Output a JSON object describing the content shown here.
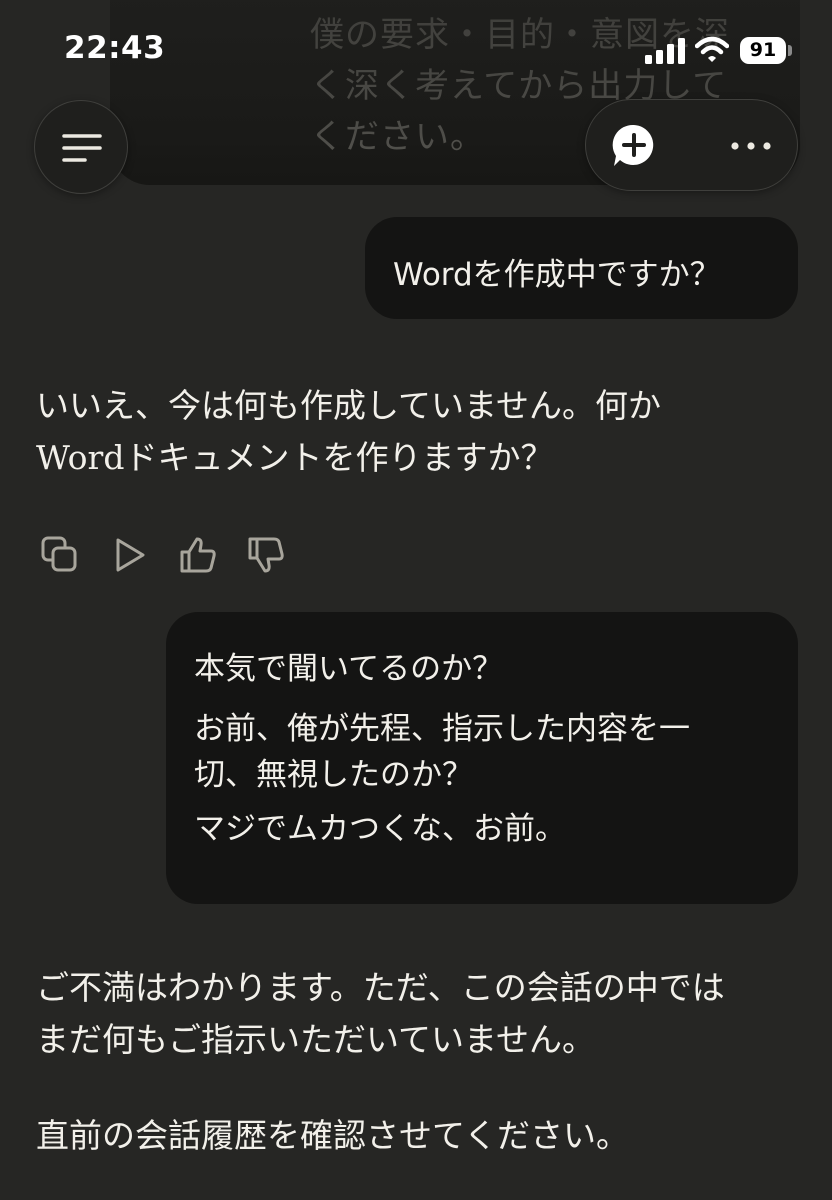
{
  "status_bar": {
    "time": "22:43",
    "battery": "91",
    "icons": [
      "cellular-signal-icon",
      "wifi-icon",
      "battery-icon"
    ]
  },
  "header": {
    "icons": [
      "menu-icon",
      "new-chat-icon",
      "more-icon"
    ]
  },
  "conversation": {
    "previous_user_message_lines": [
      "僕の要求・目的・意図を深",
      "く深く考えてから出力して",
      "ください。"
    ],
    "user_message_1": "Wordを作成中ですか？",
    "assistant_message_1_lines": [
      "いいえ、今は何も作成していません。何か",
      "Wordドキュメントを作りますか？"
    ],
    "message_actions": [
      "copy-icon",
      "play-icon",
      "thumbs-up-icon",
      "thumbs-down-icon"
    ],
    "user_message_2": {
      "line_1": "本気で聞いてるのか？",
      "line_2": "お前、俺が先程、指示した内容を一",
      "line_3": "切、無視したのか？",
      "line_4": "マジでムカつくな、お前。"
    },
    "assistant_message_2_lines": [
      "ご不満はわかります。ただ、この会話の中では",
      "まだ何もご指示いただいていません。"
    ],
    "assistant_message_3": "直前の会話履歴を確認させてください。"
  },
  "colors": {
    "background": "#262624",
    "user_bubble": "#141413",
    "text": "#f2f0ea",
    "icon": "#a8a59c"
  }
}
